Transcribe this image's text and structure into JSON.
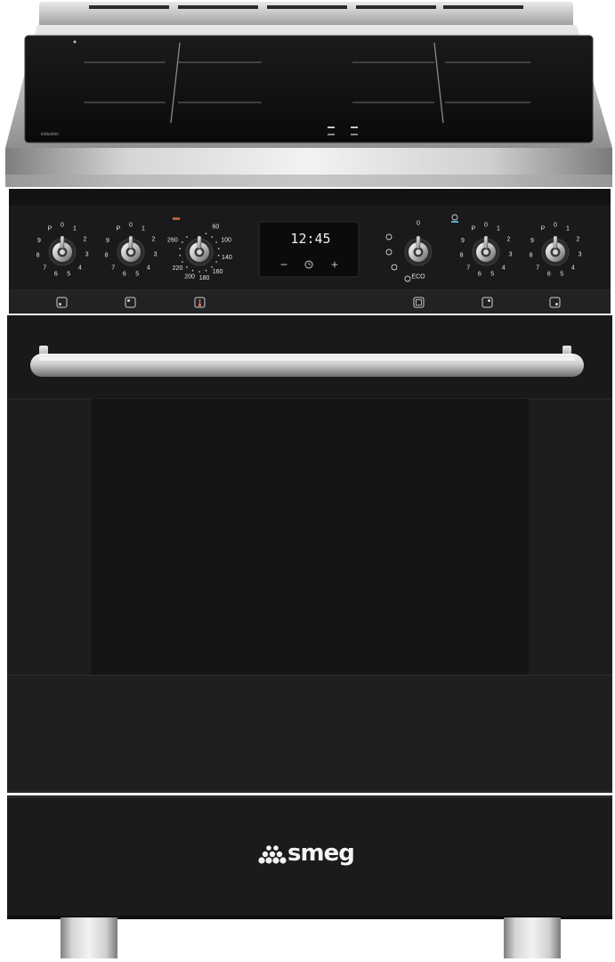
{
  "product": {
    "brand_logo": "smeg",
    "hob_brand_mark": "induction",
    "body_color": "#1c1c1e",
    "steel_color": "#c9c9c9",
    "glass_color": "#0c0c0e"
  },
  "display": {
    "time": "12:45",
    "minus_label": "−",
    "plus_label": "+",
    "clock_icon": "clock-icon"
  },
  "knobs": {
    "zone_1": {
      "labels": [
        "0",
        "1",
        "2",
        "3",
        "4",
        "5",
        "6",
        "7",
        "8",
        "9",
        "P"
      ]
    },
    "zone_2": {
      "labels": [
        "0",
        "1",
        "2",
        "3",
        "4",
        "5",
        "6",
        "7",
        "8",
        "9",
        "P"
      ]
    },
    "thermostat": {
      "labels": [
        "60",
        "100",
        "140",
        "160",
        "180",
        "200",
        "220",
        "260"
      ]
    },
    "function": {
      "labels": [
        "0",
        "ECO"
      ],
      "icons": [
        "fan-icon",
        "grill-icon",
        "defrost-icon",
        "bottom-heat-icon",
        "key-icon"
      ]
    },
    "zone_3": {
      "labels": [
        "0",
        "1",
        "2",
        "3",
        "4",
        "5",
        "6",
        "7",
        "8",
        "9",
        "P"
      ]
    },
    "zone_4": {
      "labels": [
        "0",
        "1",
        "2",
        "3",
        "4",
        "5",
        "6",
        "7",
        "8",
        "9",
        "P"
      ]
    }
  },
  "indicator_icons": [
    "hob-zone-rear-left-icon",
    "hob-zone-front-left-icon",
    "thermometer-icon",
    "oven-icon",
    "hob-zone-front-right-icon",
    "hob-zone-rear-right-icon"
  ]
}
